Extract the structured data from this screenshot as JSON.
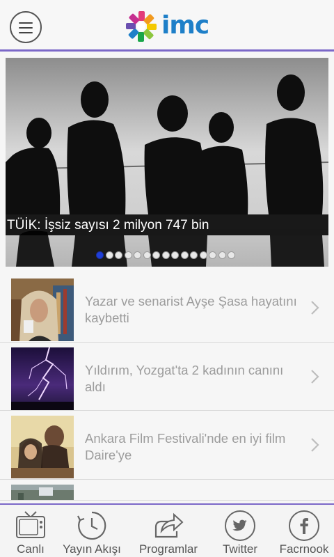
{
  "header": {
    "menu_icon": "hamburger-menu-icon",
    "logo_text": "imc"
  },
  "slider": {
    "caption": "TÜİK: İşsiz sayısı 2 milyon 747 bin",
    "slide_count": 15,
    "active_index": 0
  },
  "news": [
    {
      "title": "Yazar ve senarist Ayşe Şasa hayatını kaybetti"
    },
    {
      "title": "Yıldırım, Yozgat'ta 2 kadının canını aldı"
    },
    {
      "title": "Ankara Film Festivali'nde en iyi film Daire'ye"
    }
  ],
  "tabs": [
    {
      "label": "Canlı",
      "icon": "tv-icon"
    },
    {
      "label": "Yayın Akışı",
      "icon": "clock-refresh-icon"
    },
    {
      "label": "Programlar",
      "icon": "share-export-icon"
    },
    {
      "label": "Twitter",
      "icon": "twitter-icon"
    },
    {
      "label": "Facrnook",
      "icon": "facebook-icon"
    }
  ],
  "colors": {
    "accent": "#7b68c8",
    "logo": "#1e7fc8",
    "active_dot": "#1f3fd8"
  }
}
